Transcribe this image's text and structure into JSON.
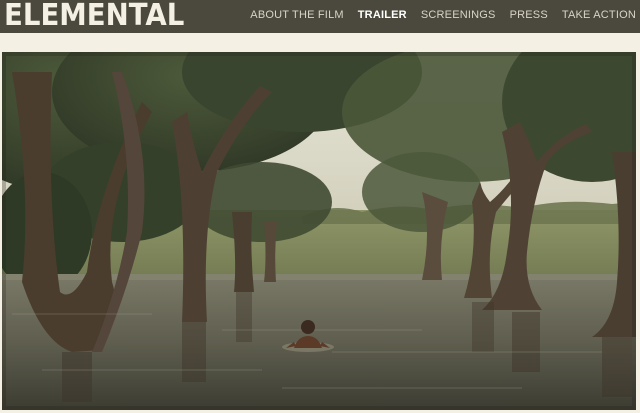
{
  "site": {
    "logo_text": "ELEMENTAL"
  },
  "nav": {
    "items": [
      {
        "label": "ABOUT THE FILM",
        "active": false
      },
      {
        "label": "TRAILER",
        "active": true
      },
      {
        "label": "SCREENINGS",
        "active": false
      },
      {
        "label": "PRESS",
        "active": false
      },
      {
        "label": "TAKE ACTION",
        "active": false
      }
    ]
  },
  "colors": {
    "header_bg": "#4b493d",
    "page_bg": "#f4f0e4",
    "nav_text": "#d8d4c6",
    "nav_active": "#ffffff"
  }
}
